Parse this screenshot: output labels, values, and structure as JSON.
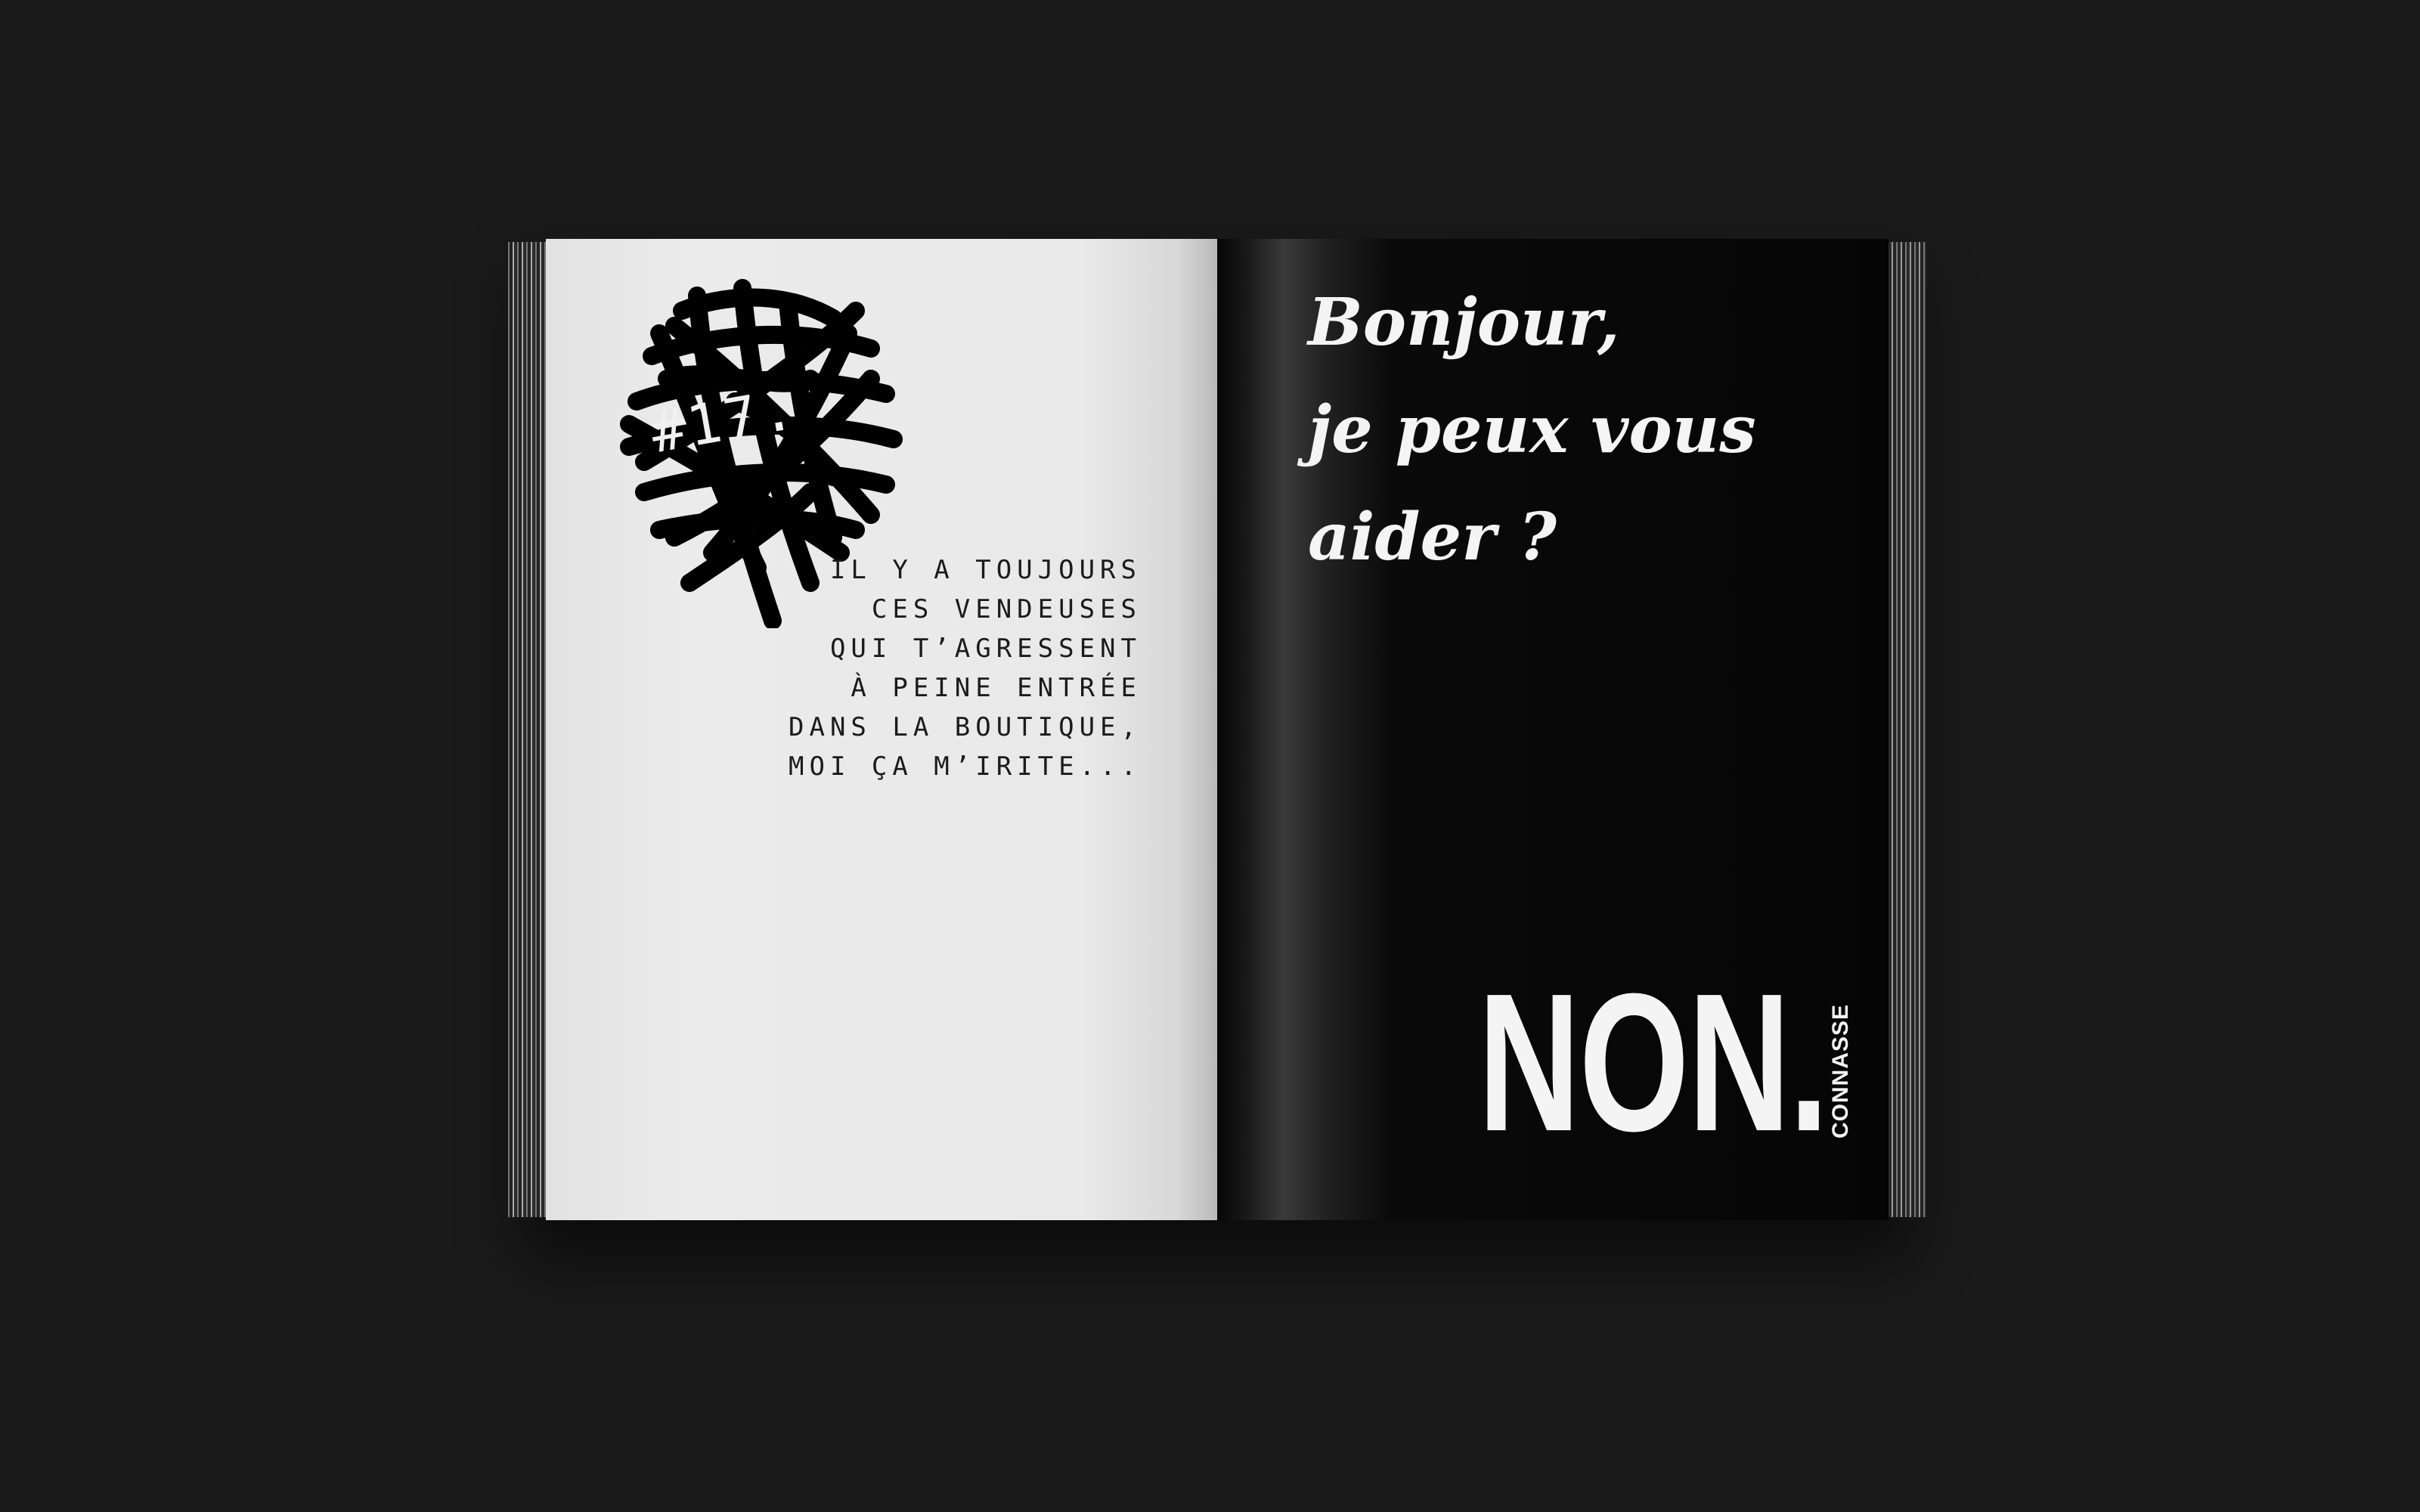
{
  "left_page": {
    "chapter_number": "#17.",
    "intro_lines": [
      "IL Y A TOUJOURS",
      "CES VENDEUSES",
      "QUI T’AGRESSENT",
      "À PEINE ENTRÉE",
      "DANS LA BOUTIQUE,",
      "MOI ÇA M’IRITE..."
    ]
  },
  "right_page": {
    "headline_lines": [
      "Bonjour,",
      "je peux vous",
      "aider ?"
    ],
    "big_word": "NON",
    "side_word": "CONNASSE"
  },
  "colors": {
    "background": "#1a1a1a",
    "left_page": "#e9e9e9",
    "right_page": "#050505",
    "ink_light": "#f4f4f4",
    "ink_dark": "#1b1b1b"
  }
}
